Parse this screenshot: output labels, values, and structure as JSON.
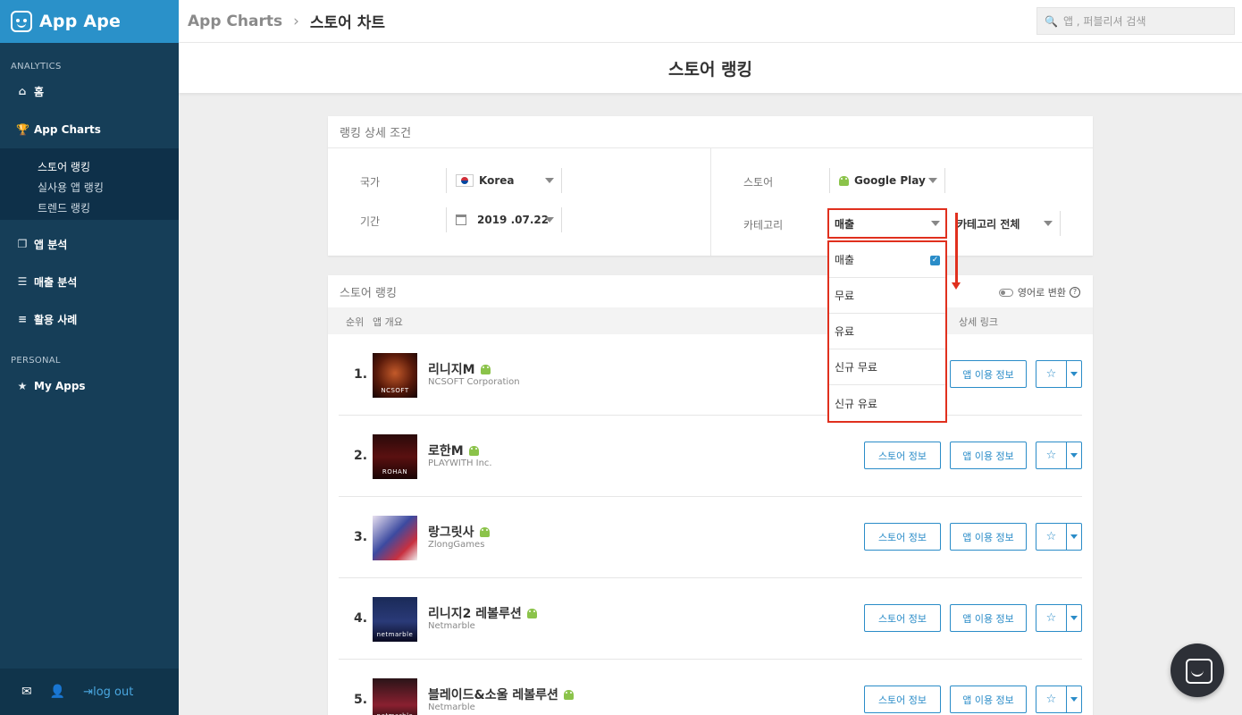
{
  "app": {
    "brand": "App Ape"
  },
  "sidebar": {
    "analytics_label": "ANALYTICS",
    "personal_label": "PERSONAL",
    "items": [
      {
        "label": "홈",
        "icon": "home-icon"
      },
      {
        "label": "App Charts",
        "icon": "trophy-icon"
      },
      {
        "label": "앱 분석",
        "icon": "copy-icon"
      },
      {
        "label": "매출 분석",
        "icon": "database-icon"
      },
      {
        "label": "활용 사례",
        "icon": "list-icon"
      },
      {
        "label": "My Apps",
        "icon": "star-icon"
      }
    ],
    "subitems": [
      {
        "label": "스토어 랭킹"
      },
      {
        "label": "실사용 앱 랭킹"
      },
      {
        "label": "트렌드 랭킹"
      }
    ],
    "footer": {
      "logout": "log out"
    }
  },
  "header": {
    "crumb1": "App Charts",
    "crumb2": "스토어 차트",
    "search_placeholder": "앱 , 퍼블리셔 검색"
  },
  "page_title": "스토어 랭킹",
  "filters": {
    "title": "랭킹 상세 조건",
    "country_label": "국가",
    "country_value": "Korea",
    "period_label": "기간",
    "period_value": "2019 .07.22",
    "store_label": "스토어",
    "store_value": "Google Play",
    "category_label": "카테고리",
    "category_value": "매출",
    "category2_value": "카테고리 전체",
    "dropdown_options": [
      "매출",
      "무료",
      "유료",
      "신규 무료",
      "신규 유료"
    ],
    "selected_option": "매출"
  },
  "ranking": {
    "title": "스토어 랭킹",
    "toggle_label": "영어로 변환",
    "columns": {
      "rank": "순위",
      "overview": "앱 개요",
      "links": "상세 링크"
    },
    "store_btn": "스토어 정보",
    "usage_btn": "앱 이용 정보",
    "rows": [
      {
        "rank": "1.",
        "name": "리니지M",
        "publisher": "NCSOFT Corporation",
        "icon_text": "NCSOFT"
      },
      {
        "rank": "2.",
        "name": "로한M",
        "publisher": "PLAYWITH Inc.",
        "icon_text": "ROHAN"
      },
      {
        "rank": "3.",
        "name": "랑그릿사",
        "publisher": "ZlongGames",
        "icon_text": ""
      },
      {
        "rank": "4.",
        "name": "리니지2 레볼루션",
        "publisher": "Netmarble",
        "icon_text": "netmarble"
      },
      {
        "rank": "5.",
        "name": "블레이드&소울 레볼루션",
        "publisher": "Netmarble",
        "icon_text": "netmarble"
      }
    ]
  },
  "colors": {
    "brand_blue": "#2a91c9",
    "sidebar_dark": "#163e58",
    "accent_red": "#e0301e",
    "button_blue": "#2a8cc8"
  }
}
